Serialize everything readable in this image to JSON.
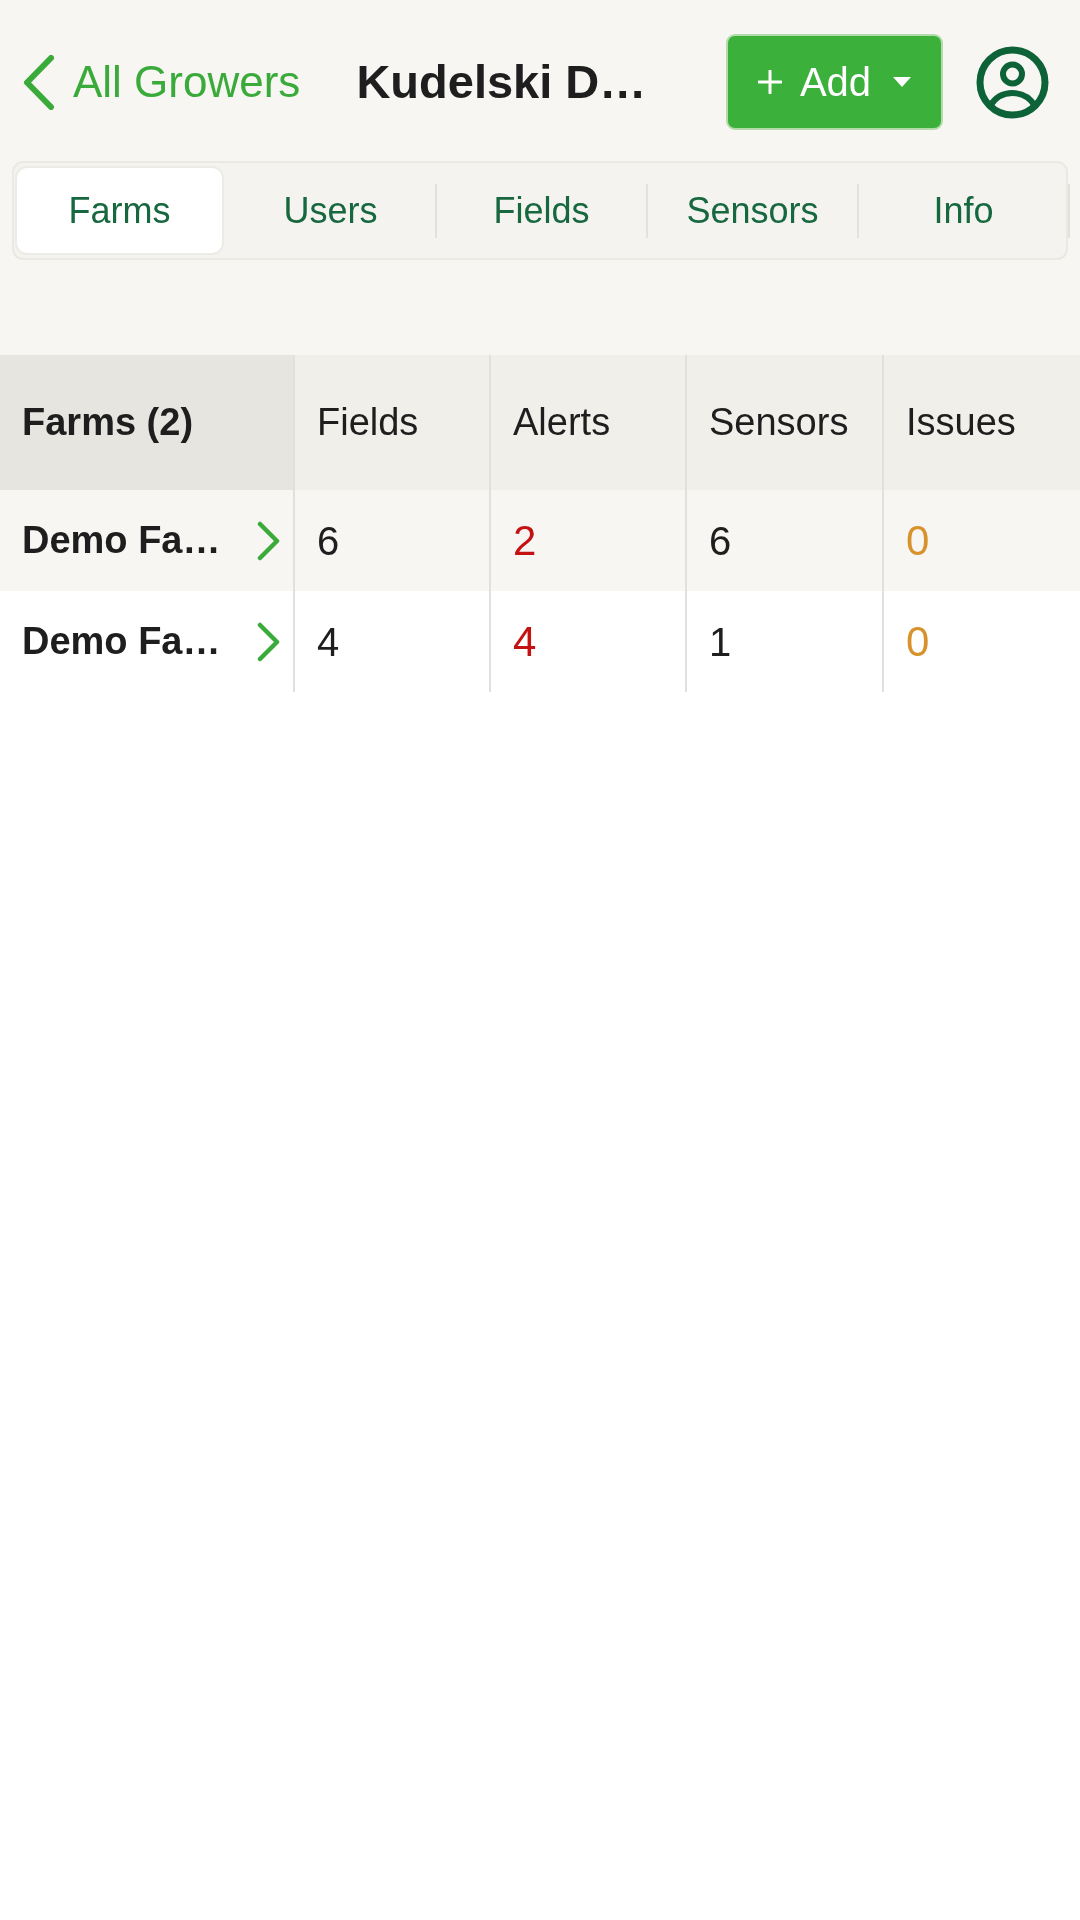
{
  "header": {
    "back_link": "All Growers",
    "title": "Kudelski D…",
    "add_button": "Add"
  },
  "tabs": [
    {
      "label": "Farms",
      "selected": true
    },
    {
      "label": "Users",
      "selected": false
    },
    {
      "label": "Fields",
      "selected": false
    },
    {
      "label": "Sensors",
      "selected": false
    },
    {
      "label": "Info",
      "selected": false
    }
  ],
  "table": {
    "columns": [
      "Farms (2)",
      "Fields",
      "Alerts",
      "Sensors",
      "Issues"
    ],
    "rows": [
      {
        "name": "Demo Fa…",
        "fields": "6",
        "alerts": "2",
        "sensors": "6",
        "issues": "0"
      },
      {
        "name": "Demo Fa…",
        "fields": "4",
        "alerts": "4",
        "sensors": "1",
        "issues": "0"
      }
    ]
  }
}
